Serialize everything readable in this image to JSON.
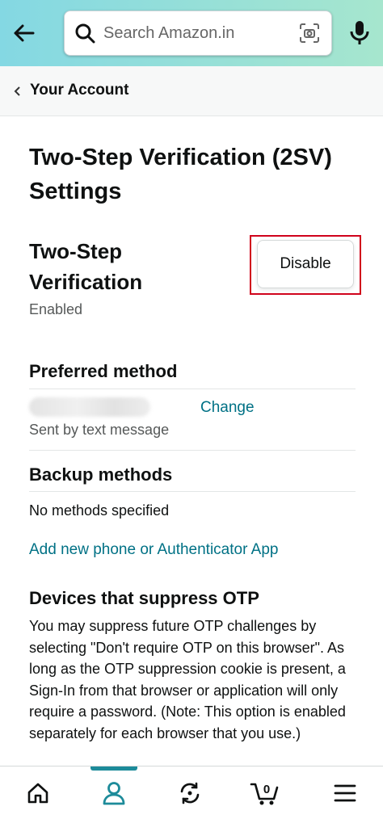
{
  "header": {
    "search_placeholder": "Search Amazon.in"
  },
  "breadcrumb": {
    "label": "Your Account"
  },
  "page": {
    "title": "Two-Step Verification (2SV) Settings"
  },
  "two_step": {
    "heading": "Two-Step Verification",
    "status": "Enabled",
    "disable_label": "Disable"
  },
  "preferred_method": {
    "heading": "Preferred method",
    "change_label": "Change",
    "delivery": "Sent by text message"
  },
  "backup_methods": {
    "heading": "Backup methods",
    "none_text": "No methods specified",
    "add_link": "Add new phone or Authenticator App"
  },
  "devices_otp": {
    "heading": "Devices that suppress OTP",
    "description": "You may suppress future OTP challenges by selecting \"Don't require OTP on this browser\". As long as the OTP suppression cookie is present, a Sign-In from that browser or application will only require a password. (Note: This option is enabled separately for each browser that you use.)"
  },
  "bottom_nav": {
    "items": [
      "home-icon",
      "account-icon",
      "refresh-icon",
      "cart-icon",
      "menu-icon"
    ],
    "cart_count": "0",
    "active_index": 1
  },
  "colors": {
    "accent_teal": "#007185",
    "highlight_red": "#d0021b",
    "active_tab": "#1d8b9a"
  }
}
